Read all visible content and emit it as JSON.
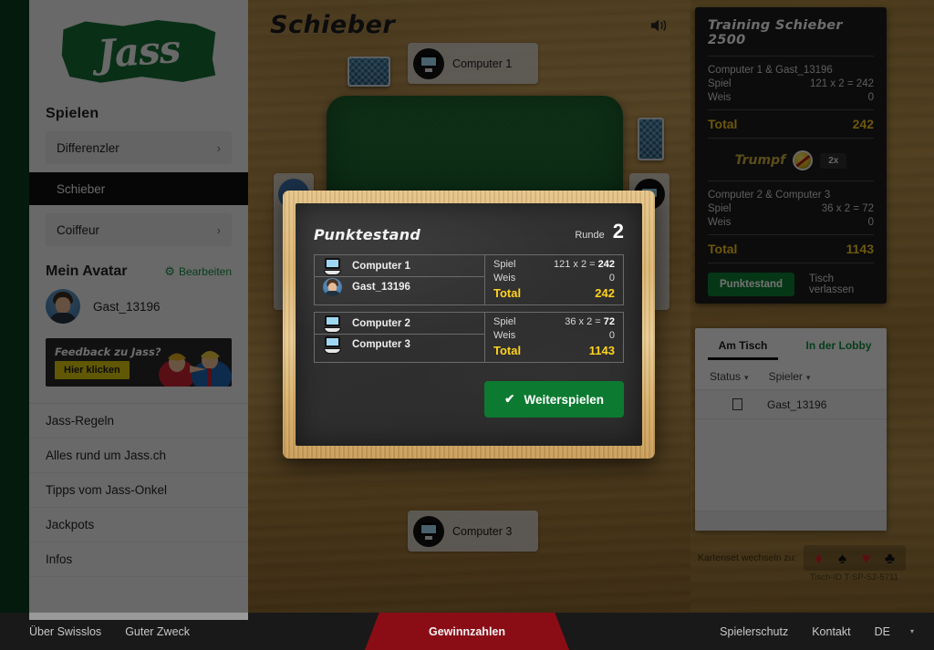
{
  "brand": {
    "logo_text": "Jass"
  },
  "sidebar": {
    "heading": "Spielen",
    "games": [
      {
        "label": "Differenzler",
        "chevron": "›",
        "active": false
      },
      {
        "label": "Schieber",
        "chevron": "",
        "active": true
      },
      {
        "label": "Coiffeur",
        "chevron": "›",
        "active": false
      }
    ],
    "avatar_section": {
      "title": "Mein Avatar",
      "edit_label": "Bearbeiten",
      "gear_icon": "⚙",
      "user_name": "Gast_13196"
    },
    "feedback": {
      "title": "Feedback zu Jass?",
      "button": "Hier klicken"
    },
    "links": [
      "Jass-Regeln",
      "Alles rund um Jass.ch",
      "Tipps vom Jass-Onkel",
      "Jackpots",
      "Infos"
    ]
  },
  "table": {
    "title": "Schieber",
    "sound_icon": "speaker-icon",
    "players": {
      "top": "Computer 1",
      "left": "Gast_13196",
      "right": "Computer 2",
      "bottom": "Computer 3"
    }
  },
  "score_panel": {
    "title": "Training Schieber 2500",
    "team_a": {
      "name": "Computer 1 & Gast_13196",
      "spiel_label": "Spiel",
      "spiel_value": "121 x 2 = 242",
      "weis_label": "Weis",
      "weis_value": "0",
      "total_label": "Total",
      "total_value": "242"
    },
    "trumpf": {
      "label": "Trumpf",
      "icon": "schellen-bell-icon",
      "multiplier": "2x"
    },
    "team_b": {
      "name": "Computer 2 & Computer 3",
      "spiel_label": "Spiel",
      "spiel_value": "36 x 2 = 72",
      "weis_label": "Weis",
      "weis_value": "0",
      "total_label": "Total",
      "total_value": "1143"
    },
    "actions": {
      "score_button": "Punktestand",
      "leave_link": "Tisch verlassen"
    }
  },
  "players_panel": {
    "tabs": [
      {
        "label": "Am Tisch",
        "active": true
      },
      {
        "label": "In der Lobby",
        "active": false
      }
    ],
    "filters": [
      {
        "label": "Status",
        "caret": "▾"
      },
      {
        "label": "Spieler",
        "caret": "▾"
      }
    ],
    "rows": [
      {
        "name": "Gast_13196"
      }
    ]
  },
  "cardset": {
    "label": "Kartenset wechseln zu:",
    "suits": [
      {
        "glyph": "♦",
        "name": "diamond-suit-icon",
        "color": "red"
      },
      {
        "glyph": "♠",
        "name": "spade-suit-icon",
        "color": "black"
      },
      {
        "glyph": "♥",
        "name": "heart-suit-icon",
        "color": "red"
      },
      {
        "glyph": "♣",
        "name": "club-suit-icon",
        "color": "black"
      }
    ],
    "table_id": "Tisch-ID T-SP-S2-5711"
  },
  "modal": {
    "title": "Punktestand",
    "round_label": "Runde",
    "round_number": "2",
    "teams": [
      {
        "players": [
          {
            "name": "Computer 1",
            "avatar": "computer-avatar"
          },
          {
            "name": "Gast_13196",
            "avatar": "human-avatar"
          }
        ],
        "spiel_label": "Spiel",
        "spiel_value": "121 x 2 = ",
        "spiel_result": "242",
        "weis_label": "Weis",
        "weis_value": "0",
        "total_label": "Total",
        "total_value": "242"
      },
      {
        "players": [
          {
            "name": "Computer 2",
            "avatar": "computer-avatar"
          },
          {
            "name": "Computer 3",
            "avatar": "computer-avatar"
          }
        ],
        "spiel_label": "Spiel",
        "spiel_value": "36 x 2 = ",
        "spiel_result": "72",
        "weis_label": "Weis",
        "weis_value": "0",
        "total_label": "Total",
        "total_value": "1143"
      }
    ],
    "continue_button": {
      "check": "✔",
      "label": "Weiterspielen"
    }
  },
  "bottom_bar": {
    "left_links": [
      "Über Swisslos",
      "Guter Zweck"
    ],
    "center_link": "Gewinnzahlen",
    "right_links": [
      "Spielerschutz",
      "Kontakt"
    ],
    "language": "DE",
    "lang_caret": "▾"
  },
  "colors": {
    "brand_green": "#146b34",
    "accent_green": "#0d7a31",
    "gold": "#ffd21f",
    "panel_dark": "#1b1b1b",
    "red_tab": "#8a0d16"
  }
}
